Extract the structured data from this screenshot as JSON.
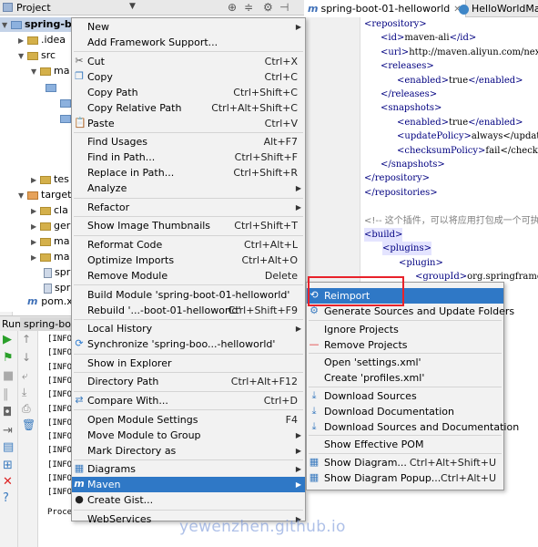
{
  "project_panel": {
    "title": "Project",
    "tree": [
      {
        "label": "spring-bo",
        "type": "root"
      },
      {
        "label": ".idea",
        "type": "folder"
      },
      {
        "label": "src",
        "type": "folder"
      },
      {
        "label": "ma",
        "type": "folder"
      },
      {
        "label": "tes",
        "type": "folder"
      },
      {
        "label": "target",
        "type": "folder-orange"
      },
      {
        "label": "cla",
        "type": "folder"
      },
      {
        "label": "ger",
        "type": "folder"
      },
      {
        "label": "ma",
        "type": "folder"
      },
      {
        "label": "ma",
        "type": "folder"
      },
      {
        "label": "spr",
        "type": "file"
      },
      {
        "label": "spr",
        "type": "file"
      }
    ],
    "pom_file": "pom.x"
  },
  "tabs": [
    {
      "label": "spring-boot-01-helloworld",
      "prefix": "m",
      "active": true
    },
    {
      "label": "HelloWorldMain",
      "active": false
    }
  ],
  "editor_lines": [
    {
      "text": "<repository>",
      "indent": 0
    },
    {
      "text": "<id>maven-ali</id>",
      "indent": 1
    },
    {
      "text": "<url>http://maven.aliyun.com/nexus/",
      "indent": 1
    },
    {
      "text": "<releases>",
      "indent": 1
    },
    {
      "text": "<enabled>true</enabled>",
      "indent": 2
    },
    {
      "text": "</releases>",
      "indent": 1
    },
    {
      "text": "<snapshots>",
      "indent": 1
    },
    {
      "text": "<enabled>true</enabled>",
      "indent": 2
    },
    {
      "text": "<updatePolicy>always</updateP",
      "indent": 2
    },
    {
      "text": "<checksumPolicy>fail</checksu",
      "indent": 2
    },
    {
      "text": "</snapshots>",
      "indent": 1
    },
    {
      "text": "</repository>",
      "indent": 0
    },
    {
      "text": "</repositories>",
      "indent": -1
    },
    {
      "text": "",
      "indent": 0
    },
    {
      "text": "<!-- 这个插件，可以将应用打包成一个可执行",
      "indent": -1
    },
    {
      "text": "<build>",
      "indent": -1
    },
    {
      "text": "<plugins>",
      "indent": 0
    },
    {
      "text": "<plugin>",
      "indent": 1
    },
    {
      "text": "<groupId>org.springframework",
      "indent": 2
    }
  ],
  "run_panel": {
    "title": "Run",
    "tab_label": "spring-bo",
    "console_lines": [
      "[INFO",
      "[INFO",
      "[INFO",
      "[INFO",
      "[INFO",
      "[INFO",
      "[INFO",
      "[INFO",
      "[INFO",
      "[INFO",
      "[INFO",
      "[INFO",
      "Proce"
    ]
  },
  "context_menu": {
    "items": [
      {
        "label": "New",
        "submenu": true
      },
      {
        "label": "Add Framework Support..."
      },
      {
        "sep": true
      },
      {
        "label": "Cut",
        "shortcut": "Ctrl+X",
        "icon": "scissors-icon"
      },
      {
        "label": "Copy",
        "shortcut": "Ctrl+C",
        "icon": "copy-icon"
      },
      {
        "label": "Copy Path",
        "shortcut": "Ctrl+Shift+C"
      },
      {
        "label": "Copy Relative Path",
        "shortcut": "Ctrl+Alt+Shift+C"
      },
      {
        "label": "Paste",
        "shortcut": "Ctrl+V",
        "icon": "paste-icon"
      },
      {
        "sep": true
      },
      {
        "label": "Find Usages",
        "shortcut": "Alt+F7"
      },
      {
        "label": "Find in Path...",
        "shortcut": "Ctrl+Shift+F"
      },
      {
        "label": "Replace in Path...",
        "shortcut": "Ctrl+Shift+R"
      },
      {
        "label": "Analyze",
        "submenu": true
      },
      {
        "sep": true
      },
      {
        "label": "Refactor",
        "submenu": true
      },
      {
        "sep": true
      },
      {
        "label": "Show Image Thumbnails",
        "shortcut": "Ctrl+Shift+T"
      },
      {
        "sep": true
      },
      {
        "label": "Reformat Code",
        "shortcut": "Ctrl+Alt+L"
      },
      {
        "label": "Optimize Imports",
        "shortcut": "Ctrl+Alt+O"
      },
      {
        "label": "Remove Module",
        "shortcut": "Delete"
      },
      {
        "sep": true
      },
      {
        "label": "Build Module 'spring-boot-01-helloworld'"
      },
      {
        "label": "Rebuild '...-boot-01-helloworld'",
        "shortcut": "Ctrl+Shift+F9"
      },
      {
        "sep": true
      },
      {
        "label": "Local History",
        "submenu": true
      },
      {
        "label": "Synchronize 'spring-boo...-helloworld'",
        "icon": "sync-icon"
      },
      {
        "sep": true
      },
      {
        "label": "Show in Explorer"
      },
      {
        "sep": true
      },
      {
        "label": "Directory Path",
        "shortcut": "Ctrl+Alt+F12"
      },
      {
        "sep": true
      },
      {
        "label": "Compare With...",
        "shortcut": "Ctrl+D",
        "icon": "compare-icon"
      },
      {
        "sep": true
      },
      {
        "label": "Open Module Settings",
        "shortcut": "F4"
      },
      {
        "label": "Move Module to Group",
        "submenu": true
      },
      {
        "label": "Mark Directory as",
        "submenu": true
      },
      {
        "sep": true
      },
      {
        "label": "Diagrams",
        "submenu": true,
        "icon": "diagram-icon"
      },
      {
        "label": "Maven",
        "submenu": true,
        "icon": "maven-icon",
        "active": true
      },
      {
        "label": "Create Gist...",
        "icon": "github-icon"
      },
      {
        "sep": true
      },
      {
        "label": "WebServices",
        "submenu": true
      }
    ]
  },
  "maven_submenu": {
    "items": [
      {
        "label": "Reimport",
        "icon": "reimport-icon",
        "active": true
      },
      {
        "label": "Generate Sources and Update Folders",
        "icon": "generate-icon"
      },
      {
        "sep": true
      },
      {
        "label": "Ignore Projects"
      },
      {
        "label": "Remove Projects",
        "icon": "remove-icon"
      },
      {
        "sep": true
      },
      {
        "label": "Open 'settings.xml'"
      },
      {
        "label": "Create 'profiles.xml'"
      },
      {
        "sep": true
      },
      {
        "label": "Download Sources",
        "icon": "download-icon"
      },
      {
        "label": "Download Documentation",
        "icon": "download-icon"
      },
      {
        "label": "Download Sources and Documentation",
        "icon": "download-icon"
      },
      {
        "sep": true
      },
      {
        "label": "Show Effective POM"
      },
      {
        "sep": true
      },
      {
        "label": "Show Diagram...",
        "shortcut": "Ctrl+Alt+Shift+U",
        "icon": "diagram-icon"
      },
      {
        "label": "Show Diagram Popup...",
        "shortcut": "Ctrl+Alt+U",
        "icon": "diagram-icon"
      }
    ]
  },
  "watermark": "yewenzhen.github.io",
  "colors": {
    "menu_highlight": "#2f78c6",
    "annotation_red": "#e8222a",
    "xml_tag": "#000080"
  }
}
